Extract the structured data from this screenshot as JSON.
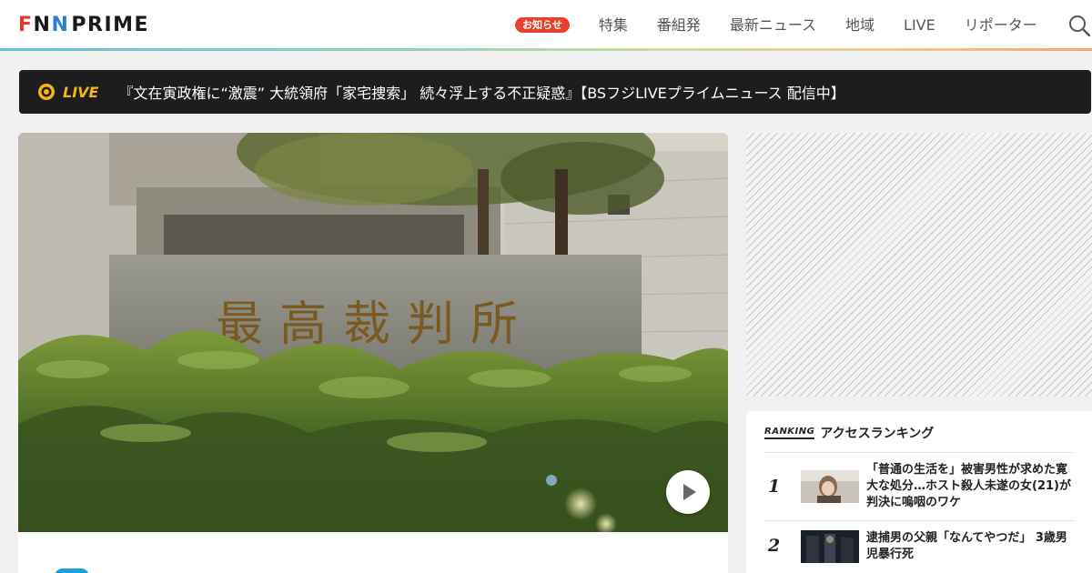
{
  "header": {
    "logo_letters": "FNN",
    "logo_word": "PRIME",
    "logo_colors": [
      "#e63b2e",
      "#1a1a1a",
      "#2a7fd4"
    ],
    "badge_label": "お知らせ",
    "nav": [
      "特集",
      "番組発",
      "最新ニュース",
      "地域",
      "LIVE",
      "リポーター"
    ],
    "search_icon": "search-icon"
  },
  "live": {
    "label": "LIVE",
    "headline": "『文在寅政権に“激震” 大統領府「家宅捜索」 続々浮上する不正疑惑』【BSフジLIVEプライムニュース 配信中】",
    "accent": "#f5b514"
  },
  "article": {
    "image_sign_text": "最高裁判所",
    "play_icon": "play-icon",
    "category_color": "#1aa0d7"
  },
  "ranking": {
    "logo_word": "RANKING",
    "title": "アクセスランキング",
    "items": [
      {
        "rank": "1",
        "title": "「普通の生活を」被害男性が求めた寛大な処分…ホスト殺人未遂の女(21)が判決に嗚咽のワケ"
      },
      {
        "rank": "2",
        "title": "逮捕男の父親「なんてやつだ」 3歳男児暴行死"
      }
    ]
  }
}
